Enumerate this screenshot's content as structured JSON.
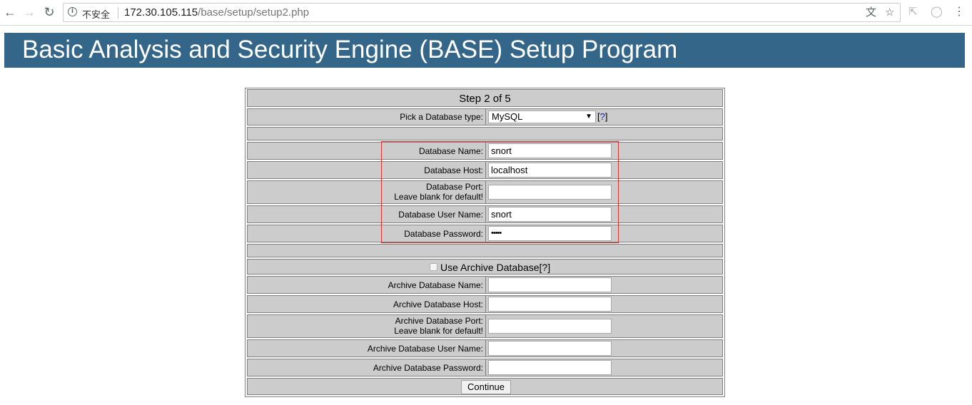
{
  "browser": {
    "security_label": "不安全",
    "url_host": "172.30.105.115",
    "url_path": "/base/setup/setup2.php"
  },
  "header": {
    "title": "Basic Analysis and Security Engine (BASE) Setup Program"
  },
  "form": {
    "step": "Step 2 of 5",
    "db_type_label": "Pick a Database type:",
    "db_type_value": "MySQL",
    "help_open": "[",
    "help_q": "?",
    "help_close": "]",
    "db_name_label": "Database Name:",
    "db_name_value": "snort",
    "db_host_label": "Database Host:",
    "db_host_value": "localhost",
    "db_port_label_1": "Database Port:",
    "db_port_label_2": "Leave blank for default!",
    "db_port_value": "",
    "db_user_label": "Database User Name:",
    "db_user_value": "snort",
    "db_pass_label": "Database Password:",
    "db_pass_value": "•••••",
    "archive_checkbox_label": "Use Archive Database",
    "archive_help": "[?]",
    "archive_name_label": "Archive Database Name:",
    "archive_host_label": "Archive Database Host:",
    "archive_port_label_1": "Archive Database Port:",
    "archive_port_label_2": "Leave blank for default!",
    "archive_user_label": "Archive Database User Name:",
    "archive_pass_label": "Archive Database Password:",
    "continue_label": "Continue"
  }
}
